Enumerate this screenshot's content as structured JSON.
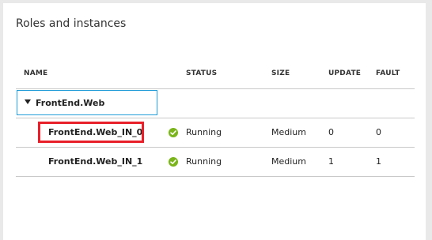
{
  "panel": {
    "title": "Roles and instances"
  },
  "table": {
    "headers": {
      "name": "NAME",
      "status": "STATUS",
      "size": "SIZE",
      "update": "UPDATE",
      "fault": "FAULT"
    },
    "group": {
      "label": "FrontEnd.Web",
      "expanded": true
    },
    "rows": [
      {
        "name": "FrontEnd.Web_IN_0",
        "status": "Running",
        "status_icon": "check-circle-icon",
        "size": "Medium",
        "update": "0",
        "fault": "0",
        "highlighted": true
      },
      {
        "name": "FrontEnd.Web_IN_1",
        "status": "Running",
        "status_icon": "check-circle-icon",
        "size": "Medium",
        "update": "1",
        "fault": "1",
        "highlighted": false
      }
    ]
  },
  "colors": {
    "accent": "#1f9bd7",
    "highlight": "#e8202a",
    "status_ok": "#7ab519",
    "divider": "#c8c8c8"
  }
}
